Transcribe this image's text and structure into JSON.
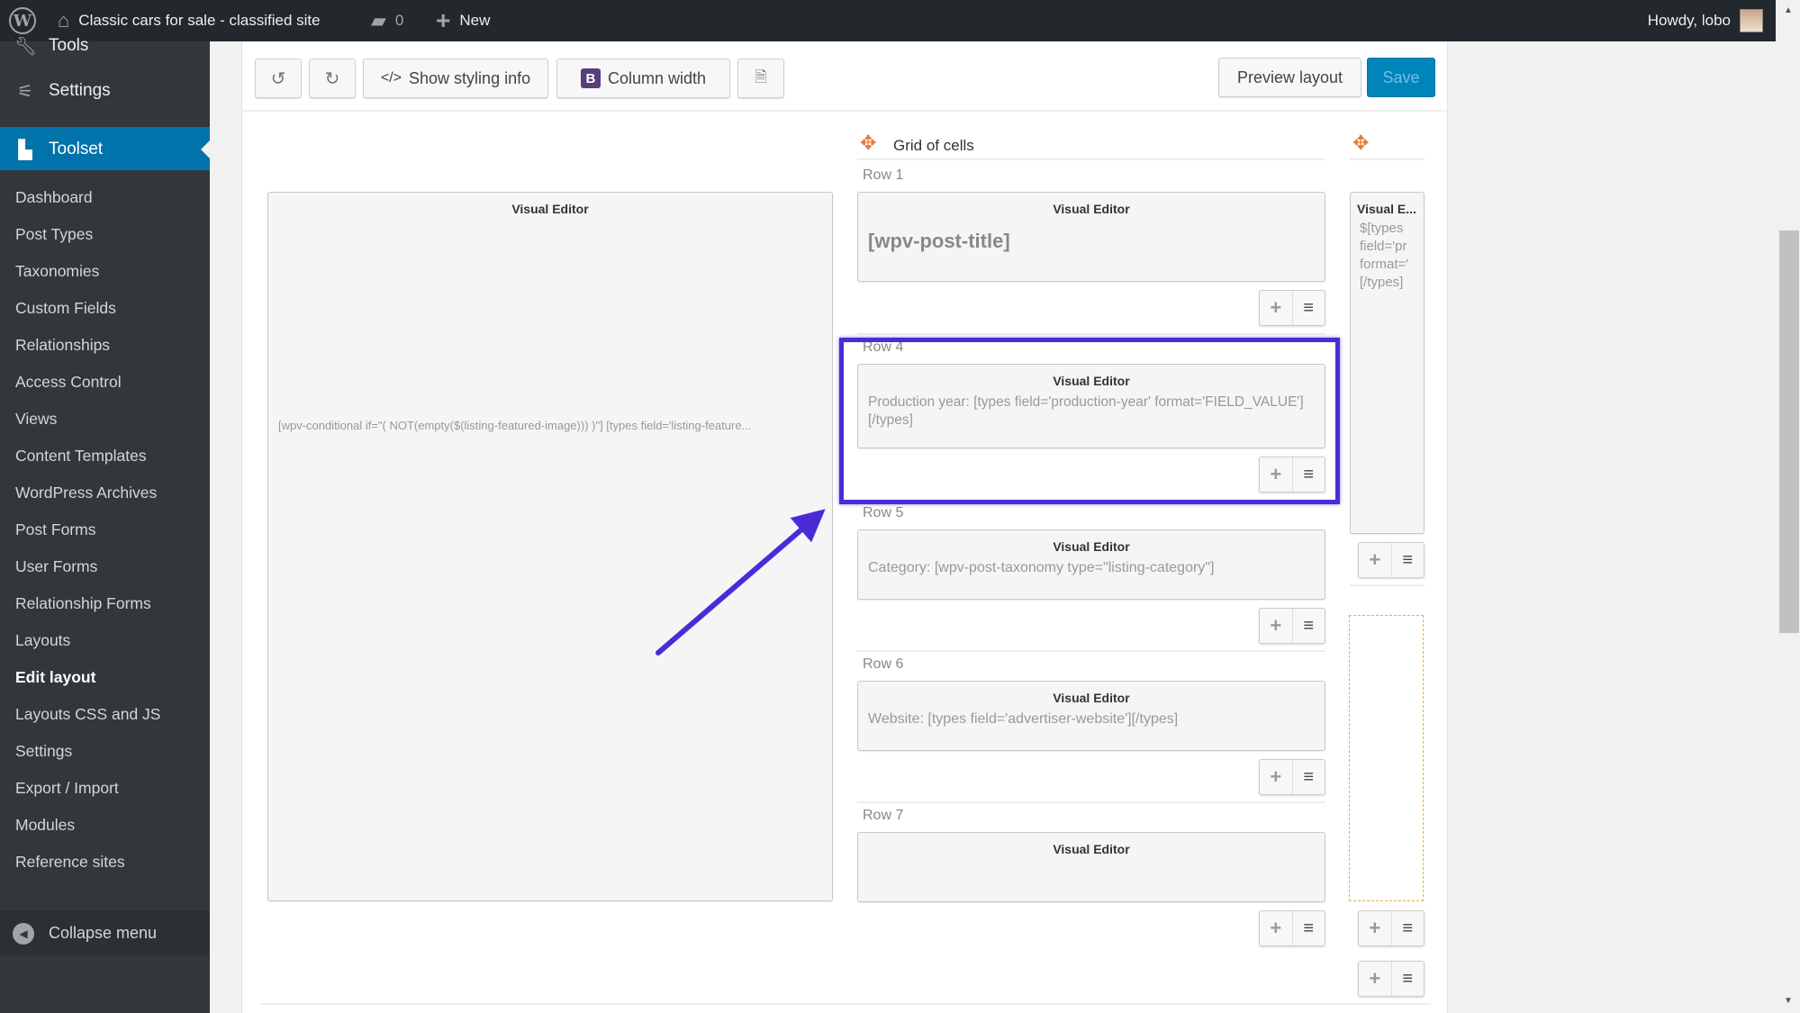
{
  "adminbar": {
    "site_name": "Classic cars for sale - classified site",
    "comments_count": "0",
    "new_label": "New",
    "howdy": "Howdy, lobo",
    "icons": [
      "wordpress-logo-icon",
      "home-icon",
      "comment-icon",
      "plus-icon",
      "avatar"
    ]
  },
  "sidebar": {
    "top_items": [
      {
        "label": "Tools",
        "icon": "wrench-icon"
      },
      {
        "label": "Settings",
        "icon": "settings-icon"
      },
      {
        "label": "Toolset",
        "icon": "toolset-icon",
        "active": true
      }
    ],
    "submenu": [
      {
        "label": "Dashboard"
      },
      {
        "label": "Post Types"
      },
      {
        "label": "Taxonomies"
      },
      {
        "label": "Custom Fields"
      },
      {
        "label": "Relationships"
      },
      {
        "label": "Access Control"
      },
      {
        "label": "Views"
      },
      {
        "label": "Content Templates"
      },
      {
        "label": "WordPress Archives"
      },
      {
        "label": "Post Forms"
      },
      {
        "label": "User Forms"
      },
      {
        "label": "Relationship Forms"
      },
      {
        "label": "Layouts"
      },
      {
        "label": "Edit layout",
        "current": true
      },
      {
        "label": "Layouts CSS and JS"
      },
      {
        "label": "Settings"
      },
      {
        "label": "Export / Import"
      },
      {
        "label": "Modules"
      },
      {
        "label": "Reference sites"
      }
    ],
    "collapse_label": "Collapse menu"
  },
  "toolbar": {
    "undo_icon": "undo-icon",
    "redo_icon": "redo-icon",
    "show_styling_label": "Show styling info",
    "show_styling_glyph": "</>",
    "column_width_label": "Column width",
    "bootstrap_glyph": "B",
    "export_icon": "code-file-icon",
    "preview_label": "Preview layout",
    "save_label": "Save"
  },
  "layout": {
    "left_cell": {
      "title": "Visual Editor",
      "content": "[wpv-conditional if=\"( NOT(empty($(listing-featured-image))) )\"] [types field='listing-feature..."
    },
    "grid": {
      "title": "Grid of cells",
      "rows": [
        {
          "label": "Row 1",
          "cell_title": "Visual Editor",
          "content": "[wpv-post-title]"
        },
        {
          "label": "Row 4",
          "cell_title": "Visual Editor",
          "content": "Production year: [types field='production-year' format='FIELD_VALUE'][/types]",
          "highlighted": true
        },
        {
          "label": "Row 5",
          "cell_title": "Visual Editor",
          "content": "Category: [wpv-post-taxonomy type=\"listing-category\"]"
        },
        {
          "label": "Row 6",
          "cell_title": "Visual Editor",
          "content": "Website: [types field='advertiser-website'][/types]"
        },
        {
          "label": "Row 7",
          "cell_title": "Visual Editor",
          "content": ""
        }
      ]
    },
    "right_cell": {
      "title": "Visual E...",
      "content_lines": [
        "$[types",
        "field='pr",
        "format='",
        "[/types]"
      ]
    },
    "control_plus": "+",
    "control_menu": "≡"
  },
  "annotation": {
    "color": "#4b2bd8"
  }
}
